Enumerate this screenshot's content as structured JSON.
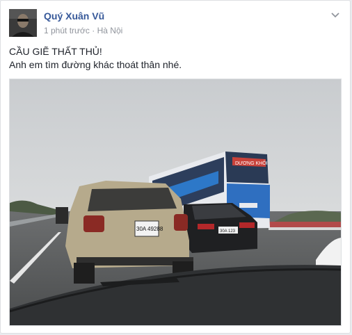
{
  "post": {
    "author": "Quý Xuân Vũ",
    "time": "1 phút trước",
    "separator": "·",
    "location": "Hà Nội",
    "text_line_1": "CẦU GIẼ THẤT THỦ!",
    "text_line_2": "Anh em tìm đường khác thoát thân nhé."
  },
  "photo": {
    "plate_front": "30A 49288",
    "plate_sedan": "30A 123",
    "bus_sign": "DƯƠNG KHÔI"
  },
  "icons": {
    "menu": "chevron-down-icon",
    "avatar": "avatar"
  },
  "colors": {
    "author": "#365899",
    "meta": "#90949c",
    "text": "#1d2129"
  }
}
